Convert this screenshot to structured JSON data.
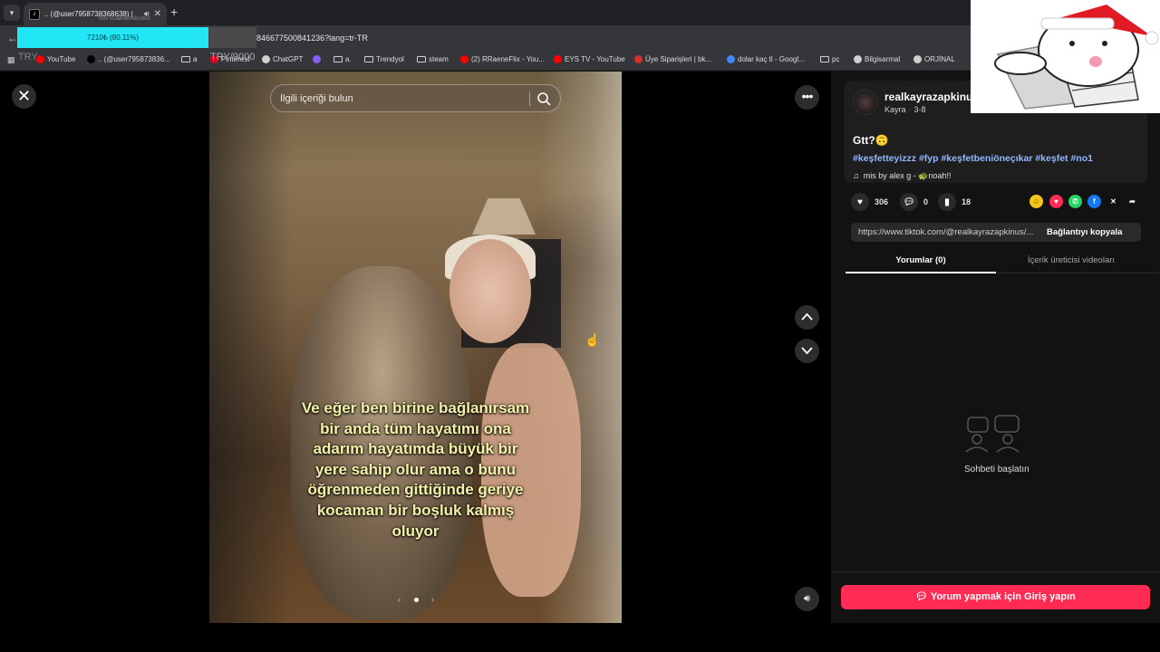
{
  "browser": {
    "tab_title": ".. (@user7958738368638) |",
    "url": "846677500841236?lang=tr-TR",
    "bookmarks": [
      {
        "label": "YouTube",
        "icon": "youtube-icon",
        "color": "#ff0000"
      },
      {
        "label": ".. (@user795873836...",
        "icon": "tiktok-icon",
        "color": "#000000"
      },
      {
        "label": "a",
        "icon": "folder-icon",
        "color": ""
      },
      {
        "label": "Pinterest",
        "icon": "pinterest-icon",
        "color": "#e60023"
      },
      {
        "label": "ChatGPT",
        "icon": "chatgpt-icon",
        "color": "#cfcfcf"
      },
      {
        "label": "",
        "icon": "feather-icon",
        "color": "#8a5cf6"
      },
      {
        "label": "a.",
        "icon": "folder-icon",
        "color": ""
      },
      {
        "label": "Trendyol",
        "icon": "folder-icon",
        "color": ""
      },
      {
        "label": "steam",
        "icon": "folder-icon",
        "color": ""
      },
      {
        "label": "(2) RRaeneFlix - You...",
        "icon": "youtube-icon",
        "color": "#ff0000"
      },
      {
        "label": "EYS TV - YouTube",
        "icon": "youtube-icon",
        "color": "#ff0000"
      },
      {
        "label": "Üye Siparişleri | bk...",
        "icon": "shop-icon",
        "color": "#d32f2f"
      },
      {
        "label": "dolar kaç tl - Googl...",
        "icon": "google-icon",
        "color": "#4285f4"
      },
      {
        "label": "pc",
        "icon": "folder-icon",
        "color": ""
      },
      {
        "label": "Bilgisarmal",
        "icon": "bilgisarmal-icon",
        "color": "#cfcfcf"
      },
      {
        "label": "ORJİNAL",
        "icon": "globe-icon",
        "color": "#cfcfcf"
      }
    ]
  },
  "overlay": {
    "progress_text": "7210₺ (80.11%)",
    "progress_fraction": 0.8011,
    "sub_text": "Yeni kulaklık/mikrofon",
    "left_text": "TRY",
    "mid_text": "TRY/9000"
  },
  "video": {
    "search_placeholder": "İlgili içeriği bulun",
    "caption": "Ve eğer ben birine bağlanırsam bir anda tüm hayatımı ona adarım hayatımda büyük bir yere sahip olur ama o bunu öğrenmeden gittiğinde geriye kocaman bir boşluk kalmış oluyor",
    "carousel_left": "‹",
    "carousel_right": "›"
  },
  "post": {
    "username": "realkayrazapkinus",
    "display_name": "Kayra",
    "date": "3-8",
    "description": "Gtt?🙃",
    "hashtags": "#keşfetteyizzz #fyp #keşfetbeniöneçıkar #keşfet #no1",
    "music": "mis by alex g - 🐢noah!!",
    "likes": "306",
    "comments": "0",
    "saves": "18",
    "link": "https://www.tiktok.com/@realkayrazapkinus/...",
    "copy_label": "Bağlantıyı kopyala",
    "tabs": [
      "Yorumlar (0)",
      "İçerik üreticisi videoları"
    ],
    "empty_text": "Sohbeti başlatın",
    "login_label": "Yorum yapmak için Giriş yapın"
  },
  "colors": {
    "accent": "#fe2c55",
    "hashtag": "#93b8ff",
    "caption": "#f4f2a8",
    "overlay": "#22e5f5"
  }
}
